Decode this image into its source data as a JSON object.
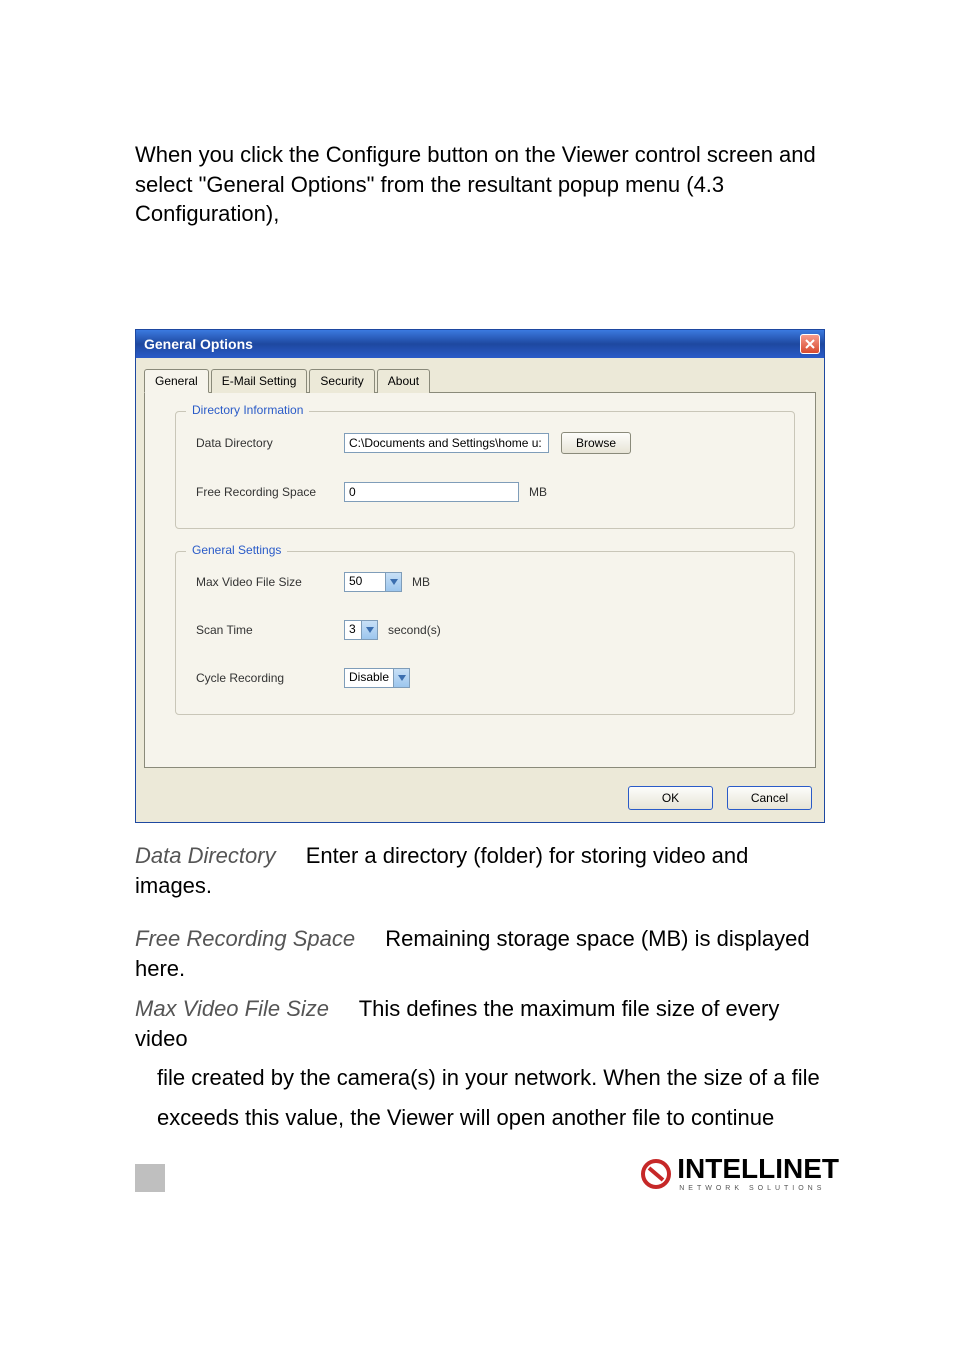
{
  "intro_text": "When you click the Configure button on the Viewer control screen and select \"General Options\" from the resultant popup menu (4.3 Configuration),",
  "dialog": {
    "title": "General Options",
    "tabs": [
      "General",
      "E-Mail Setting",
      "Security",
      "About"
    ],
    "group1": {
      "title": "Directory Information",
      "data_dir_label": "Data Directory",
      "data_dir_value": "C:\\Documents and Settings\\home u:",
      "browse_label": "Browse",
      "free_space_label": "Free Recording Space",
      "free_space_value": "0",
      "free_space_unit": "MB"
    },
    "group2": {
      "title": "General Settings",
      "max_label": "Max Video File Size",
      "max_value": "50",
      "max_unit": "MB",
      "scan_label": "Scan Time",
      "scan_value": "3",
      "scan_unit": "second(s)",
      "cycle_label": "Cycle Recording",
      "cycle_value": "Disable"
    },
    "ok_label": "OK",
    "cancel_label": "Cancel"
  },
  "definitions": {
    "dd_term": "Data Directory",
    "dd_desc": "Enter a directory (folder) for storing video and images.",
    "frs_term": "Free Recording Space",
    "frs_desc": "Remaining storage space (MB) is displayed here.",
    "mvfs_term": "Max Video File Size",
    "mvfs_desc1": "This defines the maximum file size of every video",
    "mvfs_desc2": "file created by the camera(s) in your network. When the size of a file",
    "mvfs_desc3": "exceeds this value, the Viewer will open another file to continue"
  },
  "logo": {
    "main": "INTELLINET",
    "sub": "NETWORK SOLUTIONS"
  }
}
